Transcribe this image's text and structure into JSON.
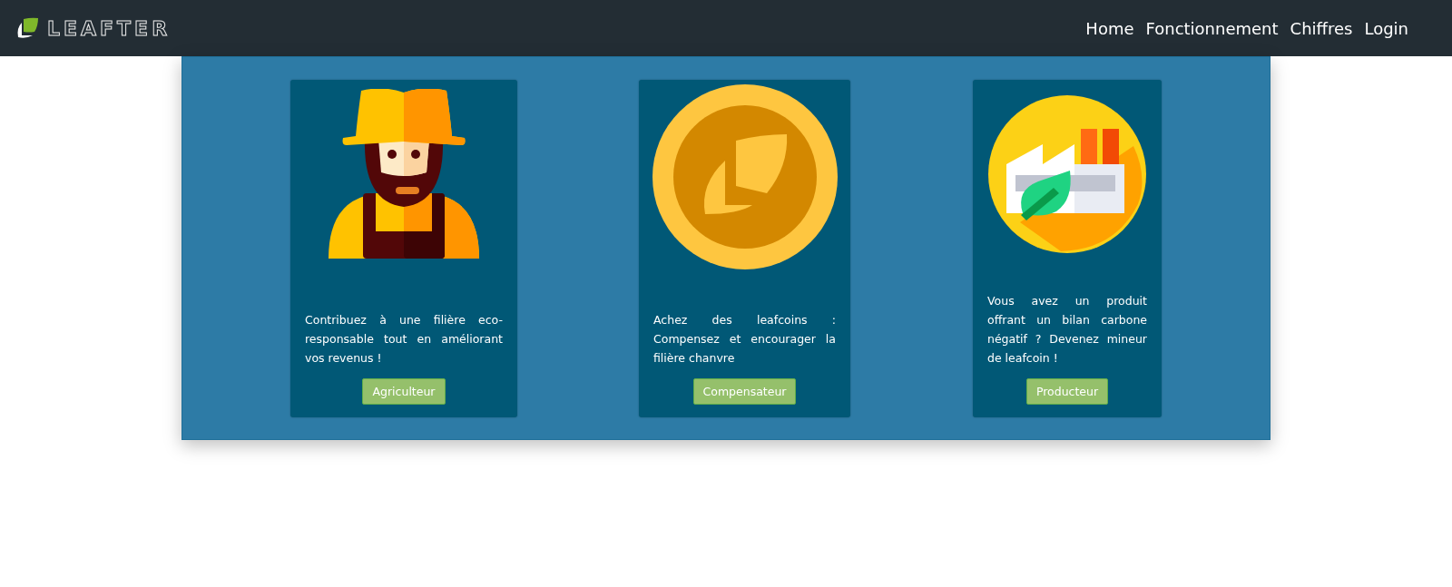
{
  "navbar": {
    "brand": "LEAFTER",
    "links": [
      "Home",
      "Fonctionnement",
      "Chiffres",
      "Login"
    ]
  },
  "cards": [
    {
      "kind": "farmer",
      "text": "Contribuez à une filière eco-responsable tout en améliorant vos revenus !",
      "button": "Agriculteur"
    },
    {
      "kind": "coin",
      "text": "Achez des leafcoins : Compensez et encourager la filière chanvre",
      "button": "Compensateur"
    },
    {
      "kind": "factory",
      "text": "Vous avez un produit offrant un bilan carbone négatif ? Devenez mineur de leafcoin !",
      "button": "Producteur"
    }
  ]
}
